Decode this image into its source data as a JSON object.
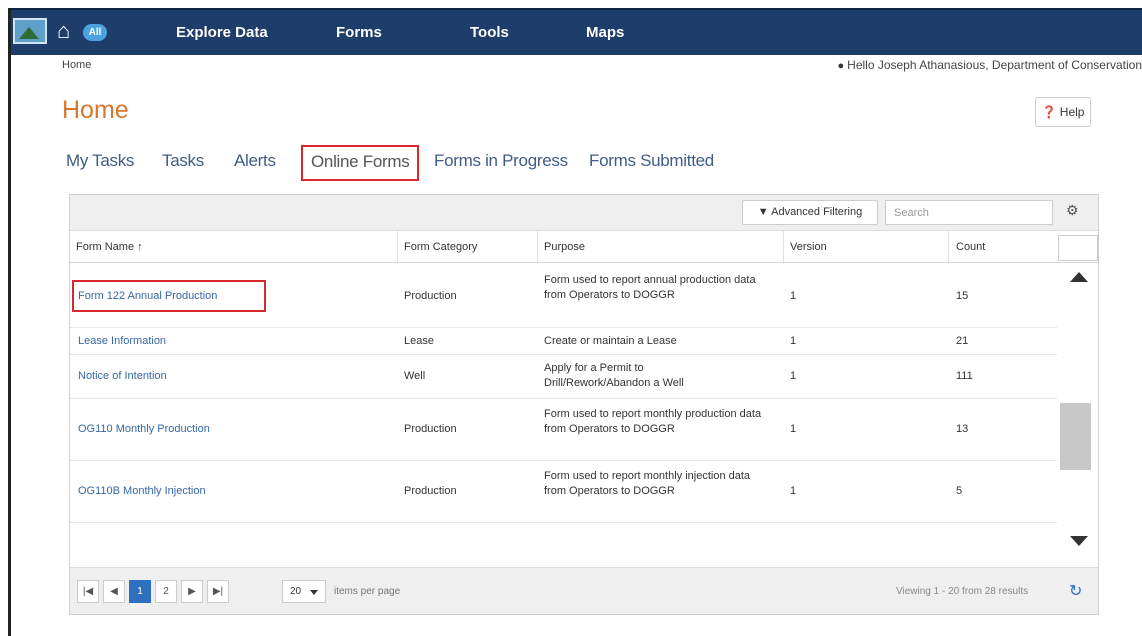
{
  "nav": {
    "badge": "All",
    "items": [
      "Explore Data",
      "Forms",
      "Tools",
      "Maps"
    ]
  },
  "breadcrumb": "Home",
  "user": {
    "greeting": "Hello Joseph Athanasious, Department of Conservation"
  },
  "page_title": "Home",
  "help_label": "Help",
  "tabs": [
    "My Tasks",
    "Tasks",
    "Alerts",
    "Online Forms",
    "Forms in Progress",
    "Forms Submitted"
  ],
  "active_tab": "Online Forms",
  "toolbar": {
    "advanced_filtering": "Advanced Filtering",
    "search_placeholder": "Search"
  },
  "table": {
    "columns": [
      "Form Name ↑",
      "Form Category",
      "Purpose",
      "Version",
      "Count"
    ],
    "rows": [
      {
        "name": "Form 122 Annual Production",
        "category": "Production",
        "purpose": "Form used to report annual production data from Operators to DOGGR",
        "version": "1",
        "count": "15"
      },
      {
        "name": "Lease Information",
        "category": "Lease",
        "purpose": "Create or maintain a Lease",
        "version": "1",
        "count": "21"
      },
      {
        "name": "Notice of Intention",
        "category": "Well",
        "purpose": "Apply for a Permit to Drill/Rework/Abandon a Well",
        "version": "1",
        "count": "111"
      },
      {
        "name": "OG110 Monthly Production",
        "category": "Production",
        "purpose": "Form used to report monthly production data from Operators to DOGGR",
        "version": "1",
        "count": "13"
      },
      {
        "name": "OG110B Monthly Injection",
        "category": "Production",
        "purpose": "Form used to report monthly injection data from Operators to DOGGR",
        "version": "1",
        "count": "5"
      }
    ]
  },
  "pager": {
    "pages": [
      "1",
      "2"
    ],
    "current_page": "1",
    "page_size": "20",
    "items_per_page_label": "items per page",
    "info": "Viewing 1 - 20 from 28 results"
  },
  "colors": {
    "navbar": "#1f3d6b",
    "title": "#d9772f",
    "link": "#3568a3",
    "highlight": "#d9272e",
    "pager_current": "#2e6fbf"
  }
}
